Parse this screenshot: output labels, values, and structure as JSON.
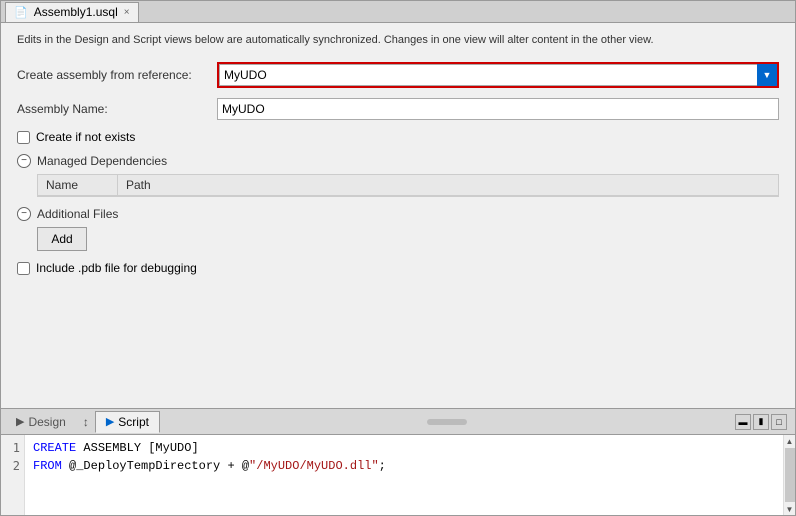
{
  "tab": {
    "label": "Assembly1.usql",
    "icon": "sql-icon",
    "close": "×"
  },
  "info": {
    "text": "Edits in the Design and Script views below are automatically synchronized. Changes in one view will alter content in the other view."
  },
  "form": {
    "create_assembly_label": "Create assembly from reference:",
    "create_assembly_value": "MyUDO",
    "assembly_name_label": "Assembly Name:",
    "assembly_name_value": "MyUDO",
    "create_if_not_exists_label": "Create if not exists"
  },
  "managed_dependencies": {
    "label": "Managed Dependencies",
    "columns": [
      "Name",
      "Path"
    ]
  },
  "additional_files": {
    "label": "Additional Files",
    "add_button": "Add"
  },
  "debugging": {
    "label": "Include .pdb file for debugging"
  },
  "panel_tabs": {
    "design": "Design",
    "script": "Script"
  },
  "code": {
    "lines": [
      {
        "num": "1",
        "content": "CREATE ASSEMBLY [MyUDO]"
      },
      {
        "num": "2",
        "content": "FROM @_DeployTempDirectory + @\"/MyUDO/MyUDO.dll\";"
      }
    ]
  },
  "panel_controls": [
    "⬛⬛",
    "⬛",
    "⬜"
  ]
}
